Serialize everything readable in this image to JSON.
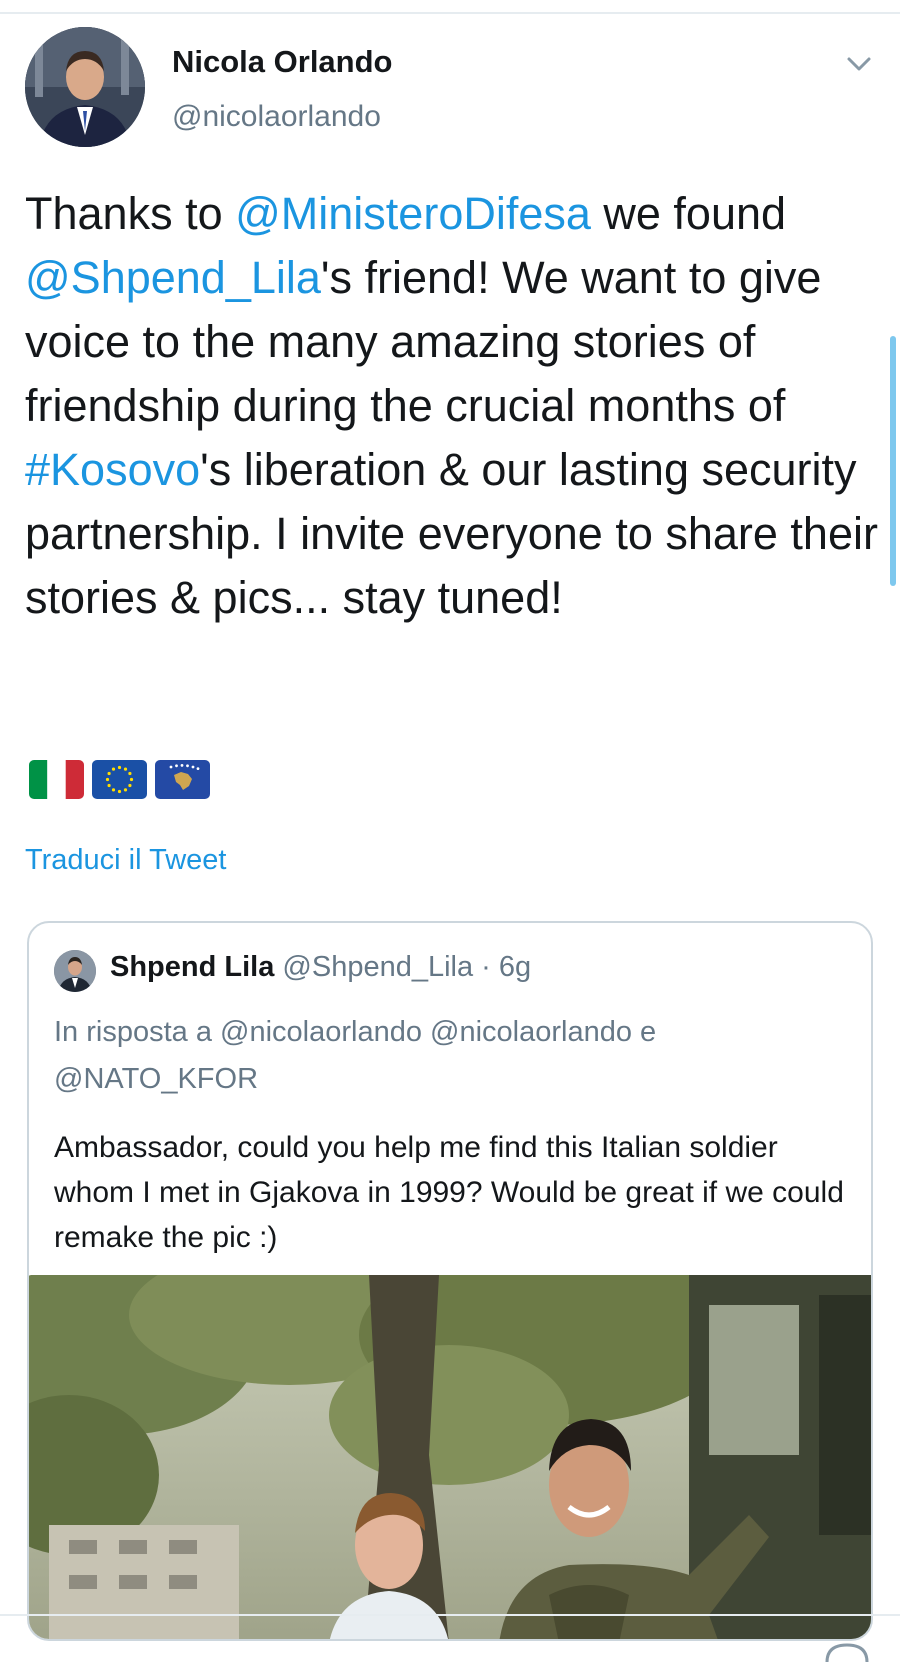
{
  "tweet": {
    "author": {
      "name": "Nicola Orlando",
      "handle": "@nicolaorlando"
    },
    "text_parts": {
      "p1": "Thanks to ",
      "m1": "@MinisteroDifesa",
      "p2": " we found ",
      "m2": "@Shpend_Lila",
      "p3": "'s friend! We want to give voice to the many amazing stories of friendship during the crucial months of ",
      "m3": "#Kosovo",
      "p4": "'s liberation & our lasting security partnership. I invite everyone to share their stories & pics... stay tuned!"
    },
    "flags": [
      "italy-flag-icon",
      "eu-flag-icon",
      "kosovo-flag-icon"
    ],
    "translate_label": "Traduci il Tweet"
  },
  "quoted_tweet": {
    "name": "Shpend Lila",
    "handle": "@Shpend_Lila",
    "time": "· 6g",
    "reply_line": "In risposta a @nicolaorlando @nicolaorlando e @NATO_KFOR",
    "text": "Ambassador, could you help me find this Italian soldier whom I met in Gjakova in 1999? Would be great if we could remake the pic :)"
  },
  "colors": {
    "link": "#1b95e0",
    "text": "#14171a",
    "secondary": "#657786",
    "border": "#ccd6dd"
  }
}
